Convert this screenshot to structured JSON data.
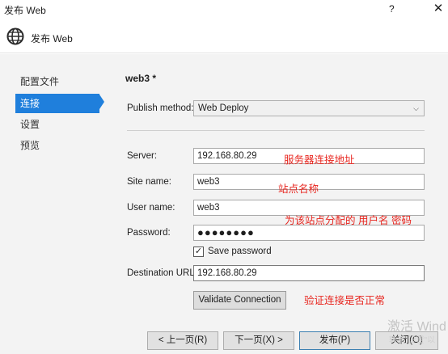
{
  "window": {
    "title": "发布 Web",
    "help": "?",
    "close": "✕"
  },
  "header": {
    "title": "发布 Web",
    "icon": "globe-icon"
  },
  "sidebar": {
    "items": [
      {
        "label": "配置文件",
        "active": false
      },
      {
        "label": "连接",
        "active": true
      },
      {
        "label": "设置",
        "active": false
      },
      {
        "label": "预览",
        "active": false
      }
    ]
  },
  "main": {
    "profile_name": "web3 *",
    "publish_method_label": "Publish method:",
    "publish_method_value": "Web Deploy",
    "server_label": "Server:",
    "server_value": "192.168.80.29",
    "site_name_label": "Site name:",
    "site_name_value": "web3",
    "user_name_label": "User name:",
    "user_name_value": "web3",
    "password_label": "Password:",
    "password_value": "●●●●●●●●",
    "save_password_label": "Save password",
    "save_password_checked": true,
    "destination_url_label": "Destination URL:",
    "destination_url_value": "192.168.80.29",
    "validate_button": "Validate Connection"
  },
  "annotations": {
    "server": "服务器连接地址",
    "site": "站点名称",
    "credentials": "为该站点分配的 用户名  密码",
    "validate": "验证连接是否正常"
  },
  "footer": {
    "prev": "< 上一页(R)",
    "next": "下一页(X) >",
    "publish": "发布(P)",
    "close": "关闭(O)"
  },
  "watermark": {
    "line1": "激活 Wind",
    "line2": "转到\"设置\"以"
  },
  "colors": {
    "accent": "#1f7fdc",
    "annotation": "#e8261f",
    "content_bg": "#f3f3f3"
  }
}
